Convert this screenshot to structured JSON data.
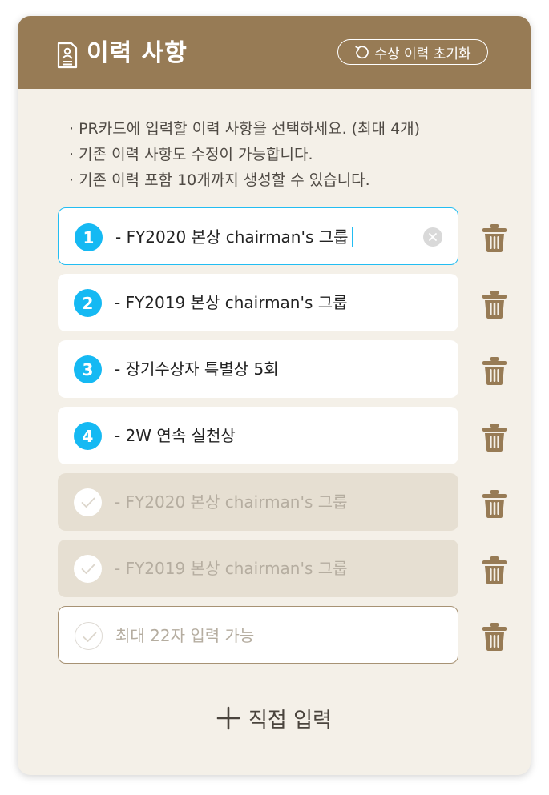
{
  "header": {
    "title": "이력 사항",
    "icon": "document-person-icon",
    "reset_label": "수상 이력 초기화",
    "reset_icon": "rotate-ccw-icon",
    "bg_color": "#977b55"
  },
  "notes": [
    "· PR카드에 입력할 이력 사항을 선택하세요. (최대 4개)",
    "· 기존 이력 사항도 수정이 가능합니다.",
    "· 기존 이력 포함 10개까지 생성할 수 있습니다."
  ],
  "items": [
    {
      "state": "editing",
      "order": "1",
      "text": "- FY2020 본상 chairman's 그룹"
    },
    {
      "state": "selected",
      "order": "2",
      "text": "- FY2019 본상 chairman's 그룹"
    },
    {
      "state": "selected",
      "order": "3",
      "text": "- 장기수상자 특별상 5회"
    },
    {
      "state": "selected",
      "order": "4",
      "text": "- 2W 연속 실천상"
    },
    {
      "state": "unselected",
      "text": "- FY2020 본상 chairman's 그룹"
    },
    {
      "state": "unselected",
      "text": "- FY2019 본상 chairman's 그룹"
    },
    {
      "state": "empty",
      "placeholder": "최대 22자 입력 가능"
    }
  ],
  "add_label": "직접 입력",
  "colors": {
    "accent_blue": "#15b9f3",
    "brown": "#977b55",
    "background": "#f4f0e8"
  }
}
